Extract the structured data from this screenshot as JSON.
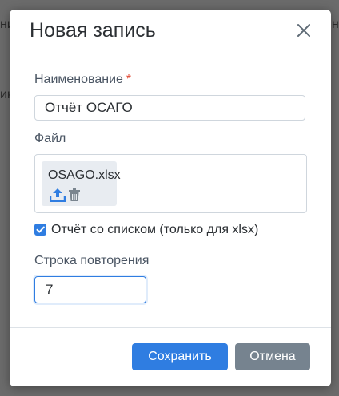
{
  "backdrop": {
    "left_fragment_1": "ни",
    "left_fragment_2": "ик",
    "right_fragment": "н"
  },
  "dialog": {
    "title": "Новая запись",
    "close_icon": "close-icon"
  },
  "fields": {
    "name": {
      "label": "Наименование",
      "required_mark": "*",
      "value": "Отчёт ОСАГО"
    },
    "file": {
      "label": "Файл",
      "file_name": "OSAGO.xlsx",
      "icons": [
        "upload-icon",
        "trash-icon"
      ]
    },
    "list_report": {
      "label": "Отчёт со списком (только для xlsx)",
      "checked": true
    },
    "repeat_row": {
      "label": "Строка повторения",
      "value": "7"
    }
  },
  "footer": {
    "save_label": "Сохранить",
    "cancel_label": "Отмена"
  },
  "colors": {
    "accent": "#2f7de1",
    "secondary": "#76838f",
    "required": "#e0442f"
  }
}
